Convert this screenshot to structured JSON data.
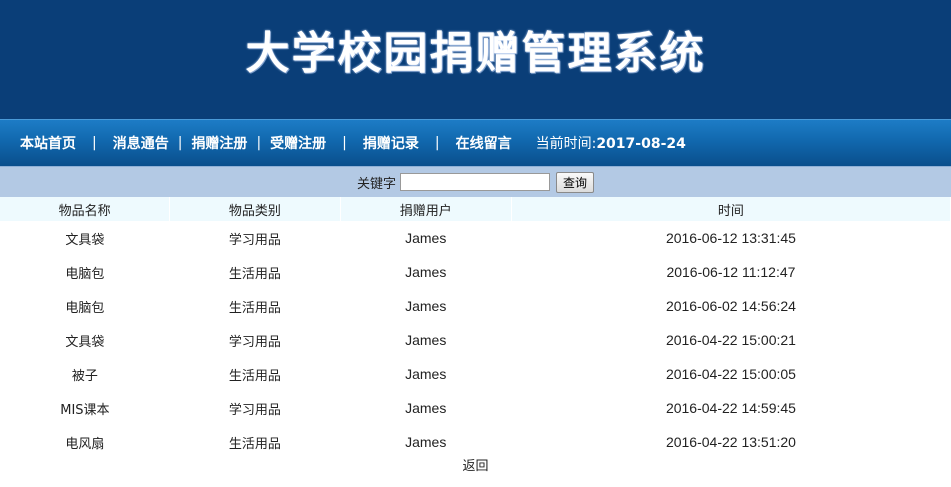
{
  "header": {
    "title": "大学校园捐赠管理系统"
  },
  "nav": {
    "items": [
      "本站首页",
      "消息通告",
      "捐赠注册",
      "受赠注册",
      "捐赠记录",
      "在线留言"
    ],
    "separator": "|",
    "current_time_label": "当前时间:",
    "current_time_value": "2017-08-24"
  },
  "search": {
    "label": "关键字",
    "value": "",
    "placeholder": "",
    "button_label": "查询"
  },
  "table": {
    "headers": [
      "物品名称",
      "物品类别",
      "捐赠用户",
      "时间"
    ],
    "rows": [
      [
        "文具袋",
        "学习用品",
        "James",
        "2016-06-12 13:31:45"
      ],
      [
        "电脑包",
        "生活用品",
        "James",
        "2016-06-12 11:12:47"
      ],
      [
        "电脑包",
        "生活用品",
        "James",
        "2016-06-02 14:56:24"
      ],
      [
        "文具袋",
        "学习用品",
        "James",
        "2016-04-22 15:00:21"
      ],
      [
        "被子",
        "生活用品",
        "James",
        "2016-04-22 15:00:05"
      ],
      [
        "MIS课本",
        "学习用品",
        "James",
        "2016-04-22 14:59:45"
      ],
      [
        "电风扇",
        "生活用品",
        "James",
        "2016-04-22 13:51:20"
      ]
    ]
  },
  "footer": {
    "back_label": "返回"
  },
  "colors": {
    "header_bg": "#0a3e78",
    "nav_bg": "#1168ae",
    "search_bg": "#b3c9e4",
    "table_header_bg": "#eefafe"
  }
}
